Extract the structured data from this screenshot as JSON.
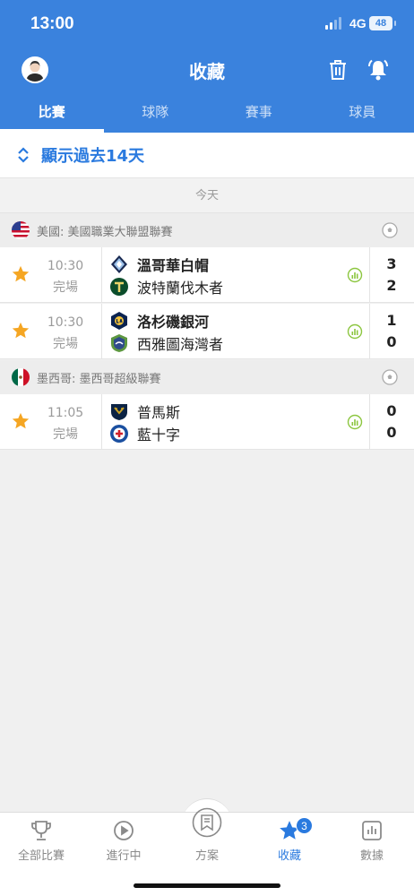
{
  "status_bar": {
    "time": "13:00",
    "network": "4G",
    "battery": "48"
  },
  "header": {
    "title": "收藏"
  },
  "tabs": [
    {
      "label": "比賽",
      "active": true
    },
    {
      "label": "球隊",
      "active": false
    },
    {
      "label": "賽事",
      "active": false
    },
    {
      "label": "球員",
      "active": false
    }
  ],
  "show_past": {
    "label": "顯示過去14天"
  },
  "today_label": "今天",
  "leagues": [
    {
      "name": "美國: 美國職業大聯盟聯賽",
      "matches": [
        {
          "time": "10:30",
          "status": "完場",
          "home": "溫哥華白帽",
          "away": "波特蘭伐木者",
          "home_score": "3",
          "away_score": "2"
        },
        {
          "time": "10:30",
          "status": "完場",
          "home": "洛杉磯銀河",
          "away": "西雅圖海灣者",
          "home_score": "1",
          "away_score": "0"
        }
      ]
    },
    {
      "name": "墨西哥: 墨西哥超級聯賽",
      "matches": [
        {
          "time": "11:05",
          "status": "完場",
          "home": "普馬斯",
          "away": "藍十字",
          "home_score": "0",
          "away_score": "0"
        }
      ]
    }
  ],
  "bottom_nav": [
    {
      "label": "全部比賽",
      "icon": "trophy-icon"
    },
    {
      "label": "進行中",
      "icon": "play-icon"
    },
    {
      "label": "方案",
      "icon": "bookmark-icon"
    },
    {
      "label": "收藏",
      "icon": "star-icon",
      "active": true,
      "badge": "3"
    },
    {
      "label": "數據",
      "icon": "chart-icon"
    }
  ],
  "colors": {
    "primary": "#3a82dd",
    "accent_star": "#f5a623",
    "stats_green": "#8cc63f"
  }
}
